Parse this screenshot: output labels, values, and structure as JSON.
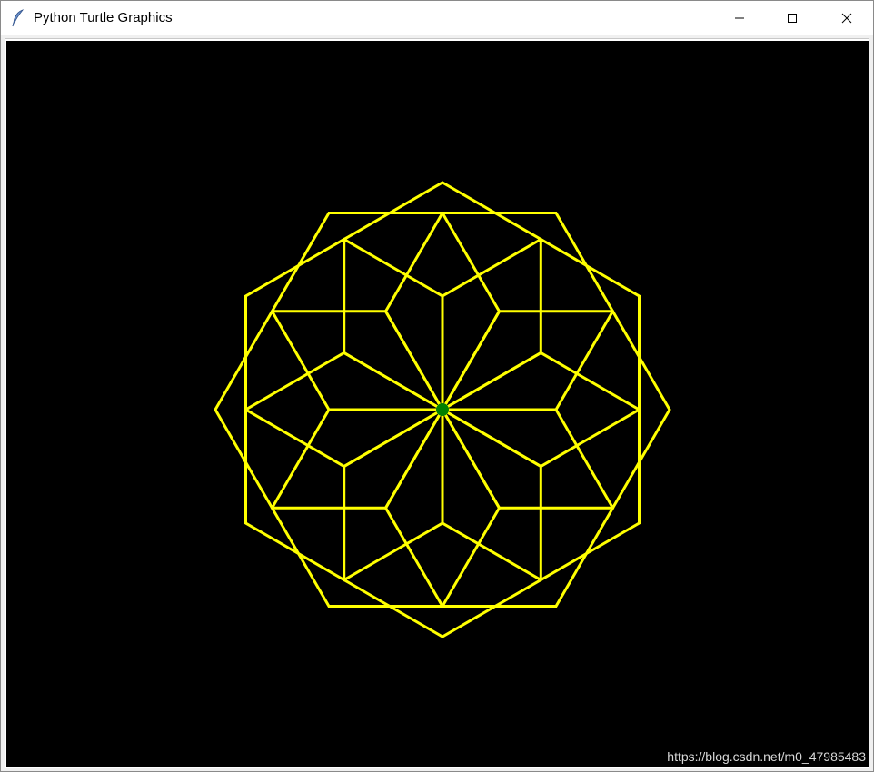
{
  "window": {
    "title": "Python Turtle Graphics",
    "app_icon": "feather-icon",
    "controls": {
      "minimize_icon": "minimize-icon",
      "maximize_icon": "maximize-icon",
      "close_icon": "close-icon"
    }
  },
  "canvas": {
    "background": "#000000",
    "pen_color": "#ffff00",
    "turtle_color": "#008000",
    "watermark": "https://blog.csdn.net/m0_47985483"
  }
}
